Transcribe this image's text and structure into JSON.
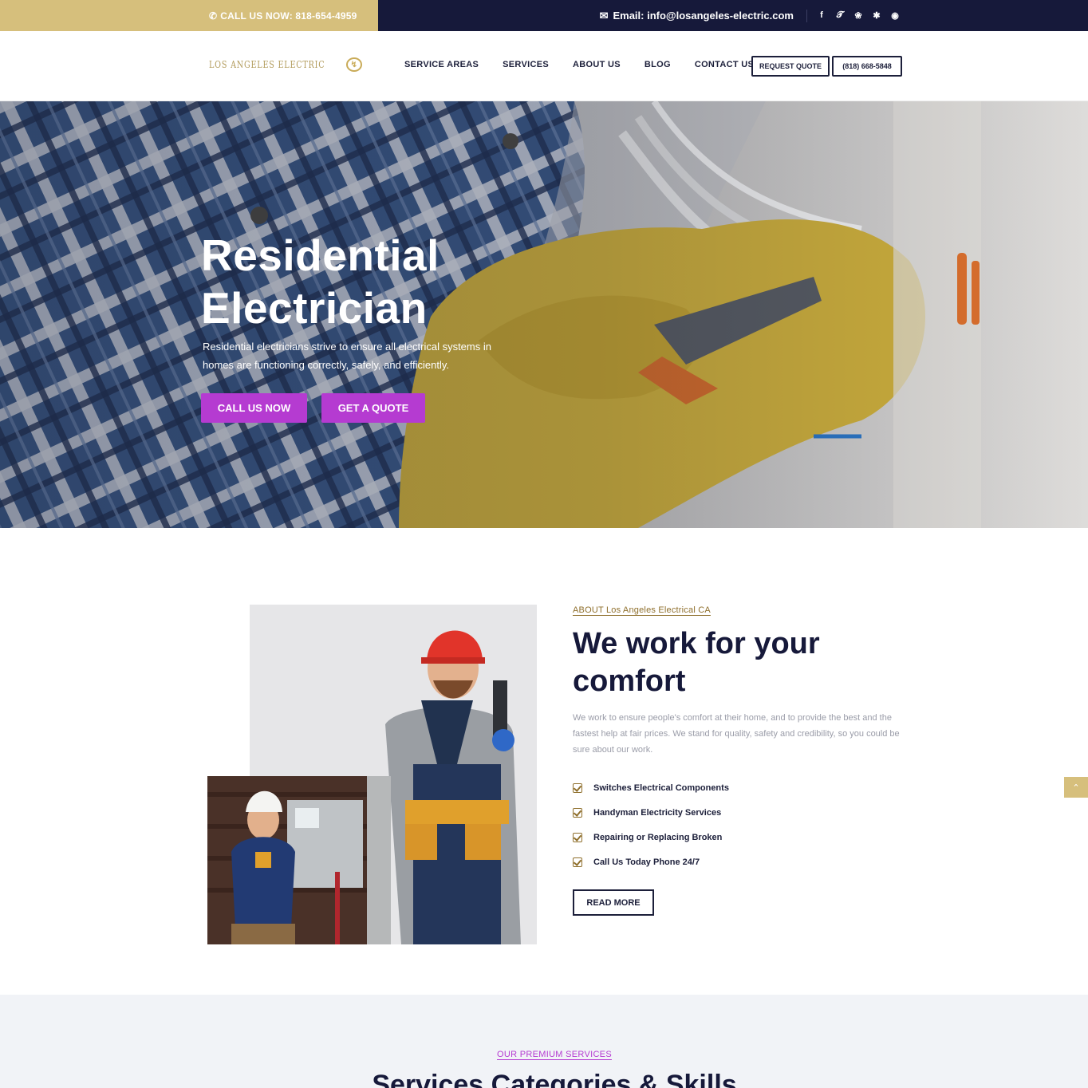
{
  "topbar": {
    "call_label": "CALL US NOW: 818-654-4959",
    "email_label": "Email: info@losangeles-electric.com",
    "social": [
      "facebook-icon",
      "twitter-icon",
      "foursquare-icon",
      "yelp-icon",
      "instagram-icon"
    ]
  },
  "header": {
    "logo_text": "LOS ANGELES ELECTRIC",
    "nav": [
      "SERVICE AREAS",
      "SERVICES",
      "ABOUT US",
      "BLOG",
      "CONTACT US"
    ],
    "request_quote": "REQUEST QUOTE",
    "phone": "(818) 668-5848"
  },
  "hero": {
    "title_line1": "Residential",
    "title_line2": "Electrician",
    "subtitle": "Residential electricians strive to ensure all electrical systems in homes are functioning correctly, safely, and efficiently.",
    "btn_call": "CALL US NOW",
    "btn_quote": "GET A QUOTE"
  },
  "about": {
    "kicker": "ABOUT Los Angeles Electrical CA",
    "title": "We work for your comfort",
    "text": "We work to ensure people's comfort at their home, and to provide the best and the fastest help at fair prices. We stand for quality, safety and credibility, so you could be sure about our work.",
    "checklist": [
      "Switches Electrical Components",
      "Handyman Electricity Services",
      "Repairing or Replacing Broken",
      "Call Us Today Phone 24/7"
    ],
    "read_more": "READ MORE"
  },
  "services": {
    "kicker": "OUR PREMIUM SERVICES",
    "title": "Services Categories & Skills"
  },
  "colors": {
    "gold": "#d6bf7c",
    "navy": "#16193a",
    "purple": "#b53bd1"
  }
}
